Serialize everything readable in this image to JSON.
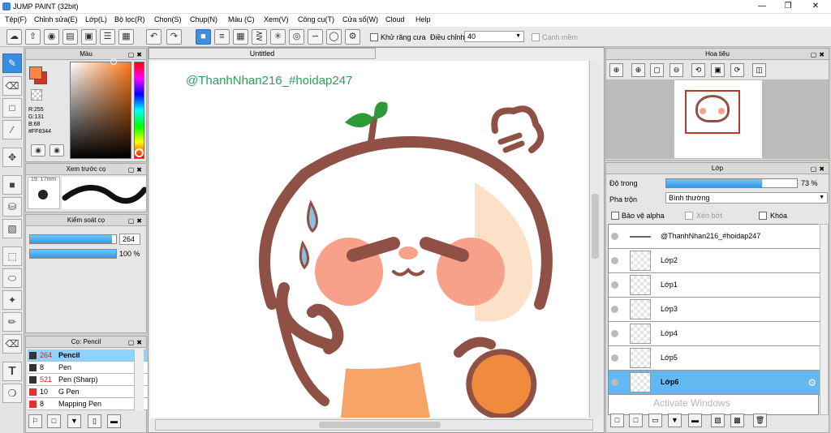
{
  "window": {
    "title": "JUMP PAINT (32bit)"
  },
  "menu": [
    "Tệp(F)",
    "Chỉnh sửa(E)",
    "Lớp(L)",
    "Bộ lọc(R)",
    "Chọn(S)",
    "Chụp(N)",
    "Màu (C)",
    "Xem(V)",
    "Công cụ(T)",
    "Cửa sổ(W)",
    "Cloud",
    "Help"
  ],
  "toolbar": {
    "antialias_label": "Khử răng cưa",
    "adjust_label": "Điều chỉnh",
    "adjust_value": "40",
    "edge_label": "Cạnh mềm"
  },
  "color_panel": {
    "title": "Màu",
    "r": "R:255",
    "g": "G:131",
    "b": "B:68",
    "hex": "#FF8344",
    "fg": "#FF8344",
    "bg": "#c0392b"
  },
  "brush_preview": {
    "title": "Xem trước cọ",
    "size": "19. 17mm"
  },
  "brush_control": {
    "title": "Kiểm soát cọ",
    "size_value": "264",
    "opacity_value": "100 %",
    "size_fraction": 0.95,
    "opacity_fraction": 1.0
  },
  "brush_list": {
    "title": "Cọ: Pencil",
    "items": [
      {
        "size": "264",
        "name": "Pencil",
        "color": "#333333"
      },
      {
        "size": "8",
        "name": "Pen",
        "color": "#333333"
      },
      {
        "size": "521",
        "name": "Pen (Sharp)",
        "color": "#333333"
      },
      {
        "size": "10",
        "name": "G Pen",
        "color": "#e03030"
      },
      {
        "size": "8",
        "name": "Mapping Pen",
        "color": "#e03030"
      }
    ]
  },
  "canvas": {
    "tab_title": "Untitled",
    "watermark_text": "@ThanhNhan216_#hoidap247"
  },
  "navigator": {
    "title": "Hoa tiêu"
  },
  "layers": {
    "title": "Lớp",
    "opacity_label": "Độ trong",
    "opacity_value": "73 %",
    "opacity_fraction": 0.73,
    "blend_label": "Pha trộn",
    "blend_value": "Bình thường",
    "protect_alpha": "Bảo vệ alpha",
    "clipping": "Xén bớt",
    "lock": "Khóa",
    "items": [
      {
        "name": "@ThanhNhan216_#hoidap247"
      },
      {
        "name": "Lớp2"
      },
      {
        "name": "Lớp1"
      },
      {
        "name": "Lớp3"
      },
      {
        "name": "Lớp4"
      },
      {
        "name": "Lớp5"
      },
      {
        "name": "Lớp6"
      }
    ]
  },
  "os_watermark": "Activate Windows"
}
